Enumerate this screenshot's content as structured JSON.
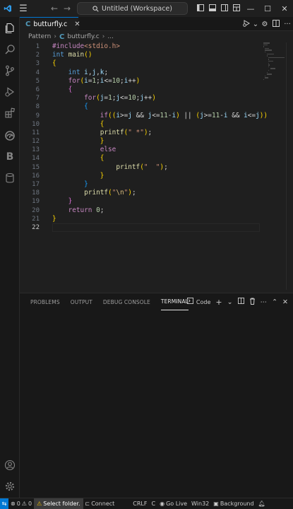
{
  "titlebar": {
    "search_text": "Untitled (Workspace)"
  },
  "tabs": [
    {
      "label": "butturfly.c",
      "icon": "c-file-icon"
    }
  ],
  "breadcrumb": {
    "folder": "Pattern",
    "file": "butturfly.c",
    "more": "..."
  },
  "editor": {
    "line_numbers": [
      "1",
      "2",
      "3",
      "4",
      "5",
      "6",
      "7",
      "8",
      "9",
      "10",
      "11",
      "12",
      "13",
      "14",
      "15",
      "16",
      "17",
      "18",
      "19",
      "20",
      "21",
      "22"
    ],
    "code_lines": [
      "#include<stdio.h>",
      "int main()",
      "{",
      "    int i,j,k;",
      "    for(i=1;i<=10;i++)",
      "    {",
      "        for(j=1;j<=10;j++)",
      "        {",
      "            if((i>=j && j<=11-i) || (j>=11-i && i<=j))",
      "            {",
      "            printf(\" *\");",
      "            }",
      "            else",
      "            {",
      "                printf(\"  \");",
      "            }",
      "        }",
      "        printf(\"\\n\");",
      "    }",
      "    return 0;",
      "}",
      ""
    ]
  },
  "panel": {
    "tabs": [
      "PROBLEMS",
      "OUTPUT",
      "DEBUG CONSOLE",
      "TERMINAL"
    ],
    "active_tab": "TERMINAL",
    "terminal_name": "Code"
  },
  "statusbar": {
    "errors": "0",
    "warnings": "0",
    "select_folder": "Select folder.",
    "connect": "Connect",
    "eol": "CRLF",
    "language": "C",
    "go_live": "Go Live",
    "platform": "Win32",
    "background": "Background"
  },
  "colors": {
    "accent": "#0078d4",
    "editor_bg": "#1f1f1f",
    "sidebar_bg": "#181818"
  }
}
